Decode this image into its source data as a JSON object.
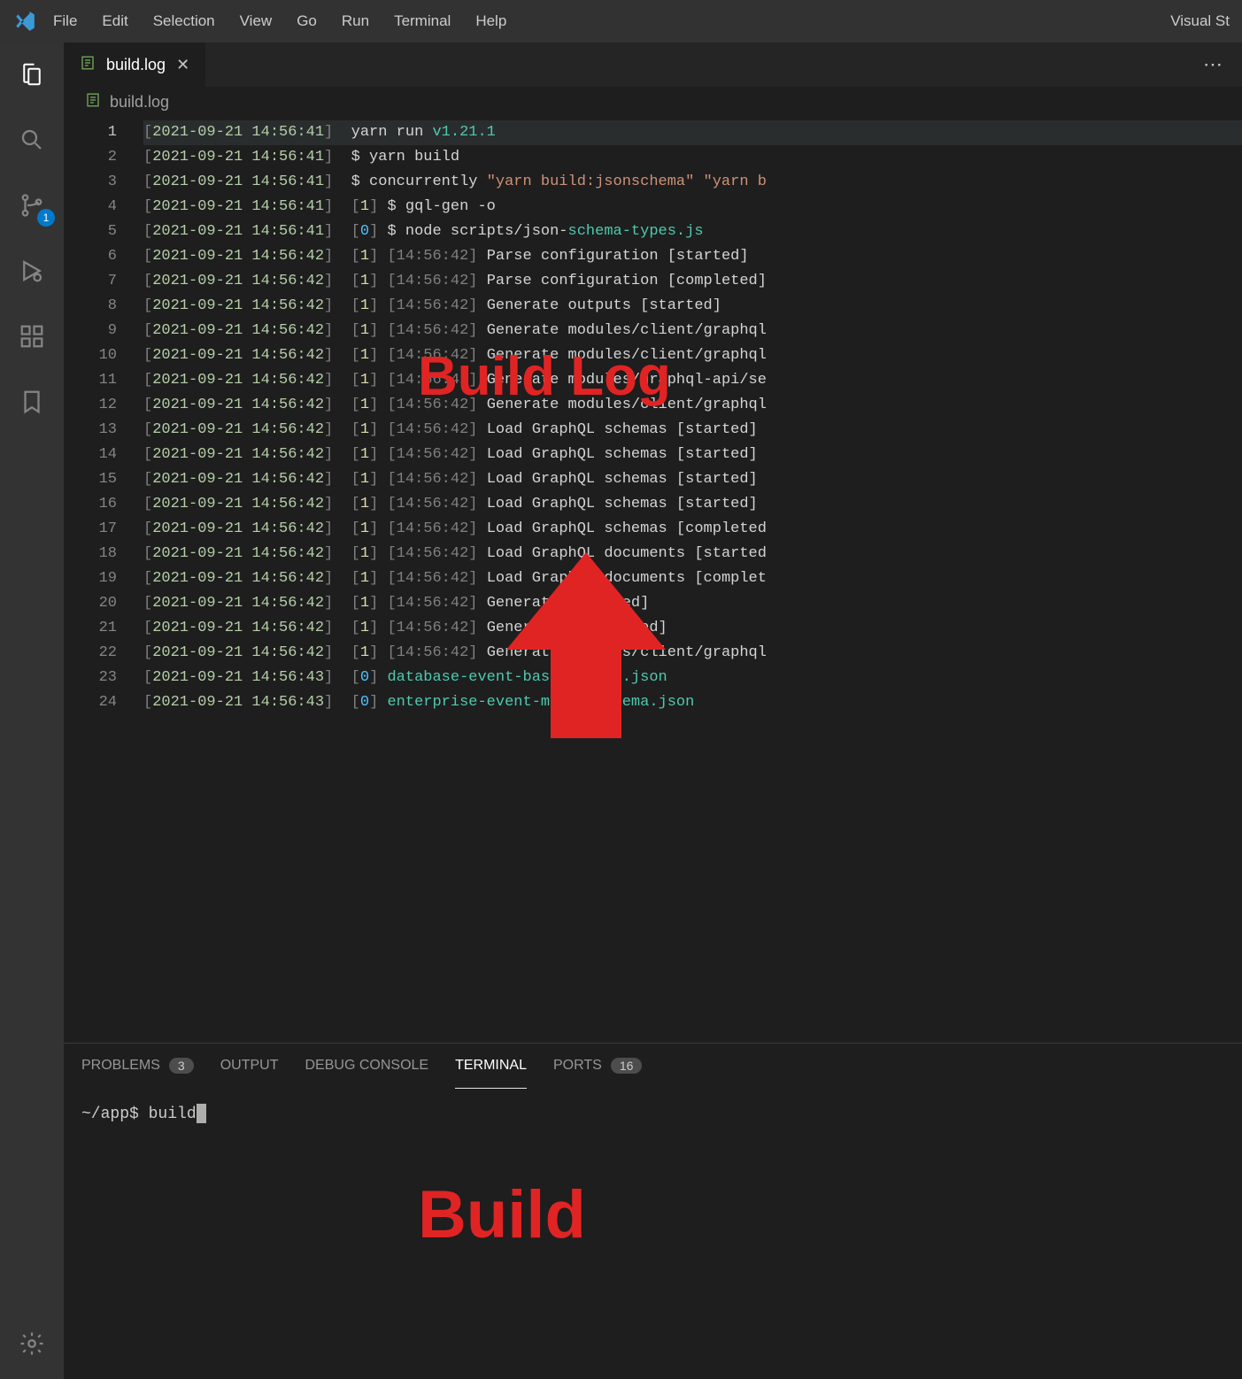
{
  "app_title_right": "Visual St",
  "menu": [
    "File",
    "Edit",
    "Selection",
    "View",
    "Go",
    "Run",
    "Terminal",
    "Help"
  ],
  "activity": {
    "source_control_badge": "1"
  },
  "tab": {
    "filename": "build.log"
  },
  "breadcrumb": {
    "filename": "build.log"
  },
  "editor": {
    "lines": [
      {
        "n": 1,
        "ts": "2021-09-21 14:56:41",
        "segs": [
          {
            "t": "  yarn run ",
            "c": "c-white"
          },
          {
            "t": "v1.21.1",
            "c": "c-ver"
          }
        ]
      },
      {
        "n": 2,
        "ts": "2021-09-21 14:56:41",
        "segs": [
          {
            "t": "  $ yarn build",
            "c": "c-white"
          }
        ]
      },
      {
        "n": 3,
        "ts": "2021-09-21 14:56:41",
        "segs": [
          {
            "t": "  $ concurrently ",
            "c": "c-white"
          },
          {
            "t": "\"yarn build:jsonschema\" \"yarn b",
            "c": "c-str"
          }
        ]
      },
      {
        "n": 4,
        "ts": "2021-09-21 14:56:41",
        "idx": "1",
        "segs": [
          {
            "t": " $ gql-gen -o",
            "c": "c-white"
          }
        ]
      },
      {
        "n": 5,
        "ts": "2021-09-21 14:56:41",
        "idx": "0",
        "segs": [
          {
            "t": " $ node scripts/json-",
            "c": "c-white"
          },
          {
            "t": "schema-types.js",
            "c": "c-link"
          }
        ]
      },
      {
        "n": 6,
        "ts": "2021-09-21 14:56:42",
        "idx": "1",
        "time2": "14:56:42",
        "segs": [
          {
            "t": " Parse configuration [started]",
            "c": "c-white"
          }
        ]
      },
      {
        "n": 7,
        "ts": "2021-09-21 14:56:42",
        "idx": "1",
        "time2": "14:56:42",
        "segs": [
          {
            "t": " Parse configuration [completed]",
            "c": "c-white"
          }
        ]
      },
      {
        "n": 8,
        "ts": "2021-09-21 14:56:42",
        "idx": "1",
        "time2": "14:56:42",
        "segs": [
          {
            "t": " Generate outputs [started]",
            "c": "c-white"
          }
        ]
      },
      {
        "n": 9,
        "ts": "2021-09-21 14:56:42",
        "idx": "1",
        "time2": "14:56:42",
        "segs": [
          {
            "t": " Generate modules/client/graphql",
            "c": "c-white"
          }
        ]
      },
      {
        "n": 10,
        "ts": "2021-09-21 14:56:42",
        "idx": "1",
        "time2": "14:56:42",
        "segs": [
          {
            "t": " Generate modules/client/graphql",
            "c": "c-white"
          }
        ]
      },
      {
        "n": 11,
        "ts": "2021-09-21 14:56:42",
        "idx": "1",
        "time2": "14:56:42",
        "segs": [
          {
            "t": " Generate modules/graphql-api/se",
            "c": "c-white"
          }
        ]
      },
      {
        "n": 12,
        "ts": "2021-09-21 14:56:42",
        "idx": "1",
        "time2": "14:56:42",
        "segs": [
          {
            "t": " Generate modules/client/graphql",
            "c": "c-white"
          }
        ]
      },
      {
        "n": 13,
        "ts": "2021-09-21 14:56:42",
        "idx": "1",
        "time2": "14:56:42",
        "segs": [
          {
            "t": " Load GraphQL schemas [started]",
            "c": "c-white"
          }
        ]
      },
      {
        "n": 14,
        "ts": "2021-09-21 14:56:42",
        "idx": "1",
        "time2": "14:56:42",
        "segs": [
          {
            "t": " Load GraphQL schemas [started]",
            "c": "c-white"
          }
        ]
      },
      {
        "n": 15,
        "ts": "2021-09-21 14:56:42",
        "idx": "1",
        "time2": "14:56:42",
        "segs": [
          {
            "t": " Load GraphQL schemas [started]",
            "c": "c-white"
          }
        ]
      },
      {
        "n": 16,
        "ts": "2021-09-21 14:56:42",
        "idx": "1",
        "time2": "14:56:42",
        "segs": [
          {
            "t": " Load GraphQL schemas [started]",
            "c": "c-white"
          }
        ]
      },
      {
        "n": 17,
        "ts": "2021-09-21 14:56:42",
        "idx": "1",
        "time2": "14:56:42",
        "segs": [
          {
            "t": " Load GraphQL schemas [completed",
            "c": "c-white"
          }
        ]
      },
      {
        "n": 18,
        "ts": "2021-09-21 14:56:42",
        "idx": "1",
        "time2": "14:56:42",
        "segs": [
          {
            "t": " Load GraphQL documents [started",
            "c": "c-white"
          }
        ]
      },
      {
        "n": 19,
        "ts": "2021-09-21 14:56:42",
        "idx": "1",
        "time2": "14:56:42",
        "segs": [
          {
            "t": " Load GraphQL documents [complet",
            "c": "c-white"
          }
        ]
      },
      {
        "n": 20,
        "ts": "2021-09-21 14:56:42",
        "idx": "1",
        "time2": "14:56:42",
        "segs": [
          {
            "t": " Generate [started]",
            "c": "c-white"
          }
        ]
      },
      {
        "n": 21,
        "ts": "2021-09-21 14:56:42",
        "idx": "1",
        "time2": "14:56:42",
        "segs": [
          {
            "t": " Generate [completed]",
            "c": "c-white"
          }
        ]
      },
      {
        "n": 22,
        "ts": "2021-09-21 14:56:42",
        "idx": "1",
        "time2": "14:56:42",
        "segs": [
          {
            "t": " Generate modules/client/graphql",
            "c": "c-white"
          }
        ]
      },
      {
        "n": 23,
        "ts": "2021-09-21 14:56:43",
        "idx": "0",
        "segs": [
          {
            "t": " database-event-base.schema.json",
            "c": "c-link"
          }
        ]
      },
      {
        "n": 24,
        "ts": "2021-09-21 14:56:43",
        "idx": "0",
        "segs": [
          {
            "t": " enterprise-event-model.schema.json",
            "c": "c-link"
          }
        ]
      }
    ]
  },
  "panel": {
    "tabs": {
      "problems": {
        "label": "PROBLEMS",
        "badge": "3"
      },
      "output": {
        "label": "OUTPUT"
      },
      "debug": {
        "label": "DEBUG CONSOLE"
      },
      "terminal": {
        "label": "TERMINAL"
      },
      "ports": {
        "label": "PORTS",
        "badge": "16"
      }
    },
    "terminal": {
      "prompt": "~/app$ ",
      "command": "build"
    }
  },
  "annotations": {
    "build_log_label": "Build Log",
    "build_label": "Build"
  }
}
